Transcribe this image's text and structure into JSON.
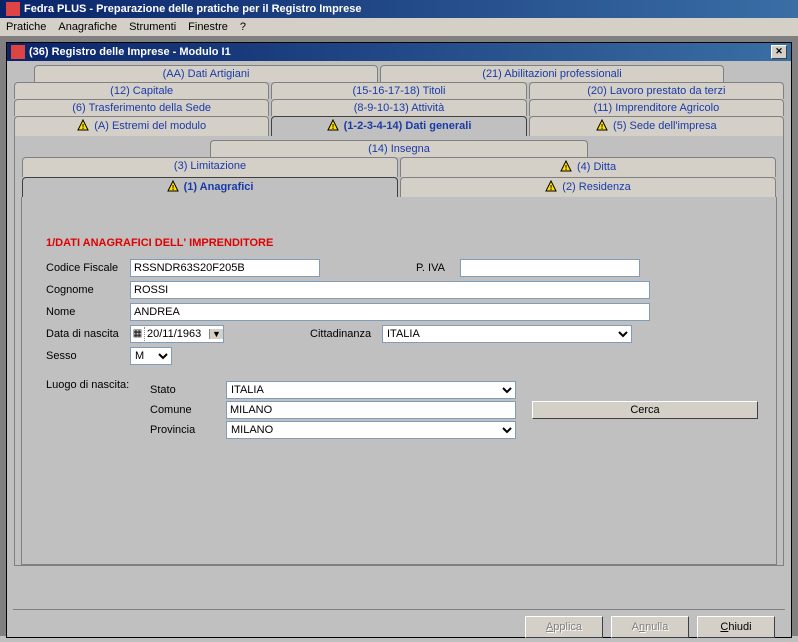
{
  "app": {
    "title": "Fedra PLUS  -  Preparazione delle pratiche per il Registro Imprese",
    "menus": [
      "Pratiche",
      "Anagrafiche",
      "Strumenti",
      "Finestre",
      "?"
    ]
  },
  "mdi": {
    "title": "(36) Registro delle Imprese - Modulo I1"
  },
  "tabs": {
    "row1": [
      {
        "label": "(AA) Dati Artigiani",
        "warn": false
      },
      {
        "label": "(21) Abilitazioni professionali",
        "warn": false
      }
    ],
    "row2": [
      {
        "label": "(12) Capitale",
        "warn": false
      },
      {
        "label": "(15-16-17-18) Titoli",
        "warn": false
      },
      {
        "label": "(20) Lavoro prestato da terzi",
        "warn": false
      }
    ],
    "row3": [
      {
        "label": "(6) Trasferimento della Sede",
        "warn": false
      },
      {
        "label": "(8-9-10-13) Attività",
        "warn": false
      },
      {
        "label": "(11) Imprenditore Agricolo",
        "warn": false
      }
    ],
    "row4": [
      {
        "label": "(A) Estremi del modulo",
        "warn": true
      },
      {
        "label": "(1-2-3-4-14) Dati generali",
        "warn": true,
        "active": true
      },
      {
        "label": "(5) Sede dell'impresa",
        "warn": true
      }
    ],
    "row5": [
      {
        "label": "(14) Insegna",
        "warn": false
      }
    ],
    "row6": [
      {
        "label": "(3) Limitazione",
        "warn": false
      },
      {
        "label": "(4) Ditta",
        "warn": true
      }
    ],
    "row7": [
      {
        "label": "(1) Anagrafici",
        "warn": true,
        "active": true
      },
      {
        "label": "(2) Residenza",
        "warn": true
      }
    ]
  },
  "form": {
    "section_title": "1/DATI ANAGRAFICI DELL' IMPRENDITORE",
    "labels": {
      "codice_fiscale": "Codice Fiscale",
      "piva": "P. IVA",
      "cognome": "Cognome",
      "nome": "Nome",
      "data_nascita": "Data di nascita",
      "cittadinanza": "Cittadinanza",
      "sesso": "Sesso",
      "luogo_nascita": "Luogo di nascita:",
      "stato": "Stato",
      "comune": "Comune",
      "provincia": "Provincia",
      "cerca": "Cerca"
    },
    "values": {
      "codice_fiscale": "RSSNDR63S20F205B",
      "piva": "",
      "cognome": "ROSSI",
      "nome": "ANDREA",
      "data_nascita": "20/11/1963",
      "cittadinanza": "ITALIA",
      "sesso": "M",
      "stato": "ITALIA",
      "comune": "MILANO",
      "provincia": "MILANO"
    }
  },
  "footer": {
    "applica": "Applica",
    "annulla": "Annulla",
    "chiudi": "Chiudi"
  }
}
